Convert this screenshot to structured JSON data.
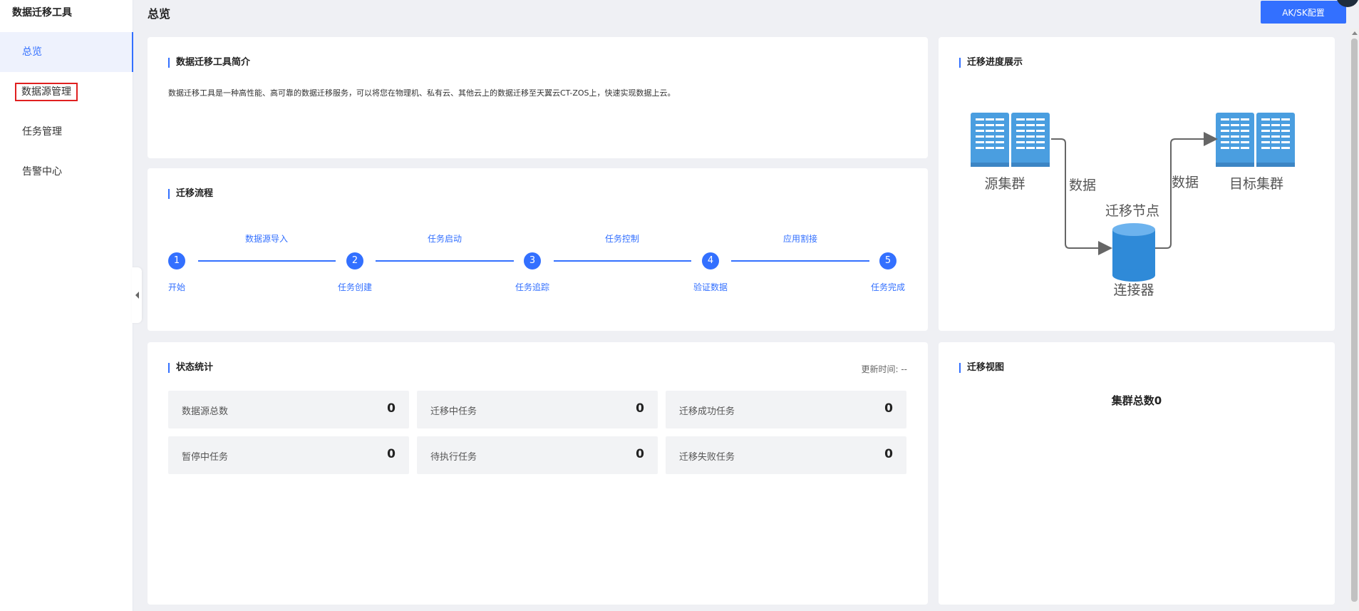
{
  "sidebar": {
    "app_title": "数据迁移工具",
    "items": [
      {
        "label": "总览"
      },
      {
        "label": "数据源管理"
      },
      {
        "label": "任务管理"
      },
      {
        "label": "告警中心"
      }
    ]
  },
  "header": {
    "page_title": "总览",
    "aksk_button": "AK/SK配置"
  },
  "intro": {
    "title": "数据迁移工具简介",
    "text": "数据迁移工具是一种高性能、高可靠的数据迁移服务，可以将您在物理机、私有云、其他云上的数据迁移至天翼云CT-ZOS上，快速实现数据上云。"
  },
  "flow": {
    "title": "迁移流程",
    "steps": [
      {
        "num": "1",
        "label": "开始"
      },
      {
        "num": "2",
        "label": "任务创建"
      },
      {
        "num": "3",
        "label": "任务追踪"
      },
      {
        "num": "4",
        "label": "验证数据"
      },
      {
        "num": "5",
        "label": "任务完成"
      }
    ],
    "stages": [
      "数据源导入",
      "任务启动",
      "任务控制",
      "应用割接"
    ]
  },
  "stats": {
    "title": "状态统计",
    "update_time": "更新时间: --",
    "items": [
      {
        "label": "数据源总数",
        "value": "0"
      },
      {
        "label": "迁移中任务",
        "value": "0"
      },
      {
        "label": "迁移成功任务",
        "value": "0"
      },
      {
        "label": "暂停中任务",
        "value": "0"
      },
      {
        "label": "待执行任务",
        "value": "0"
      },
      {
        "label": "迁移失败任务",
        "value": "0"
      }
    ]
  },
  "progress": {
    "title": "迁移进度展示",
    "source_label": "源集群",
    "target_label": "目标集群",
    "data_label_left": "数据",
    "data_label_right": "数据",
    "node_label": "迁移节点",
    "connector_label": "连接器",
    "colors": {
      "server": "#4a9ee0",
      "connector": "#2f8ad8",
      "line": "#666666"
    }
  },
  "view": {
    "title": "迁移视图",
    "cluster_total": "集群总数0"
  },
  "colors": {
    "accent": "#3370ff",
    "highlight_box": "#e02020"
  }
}
